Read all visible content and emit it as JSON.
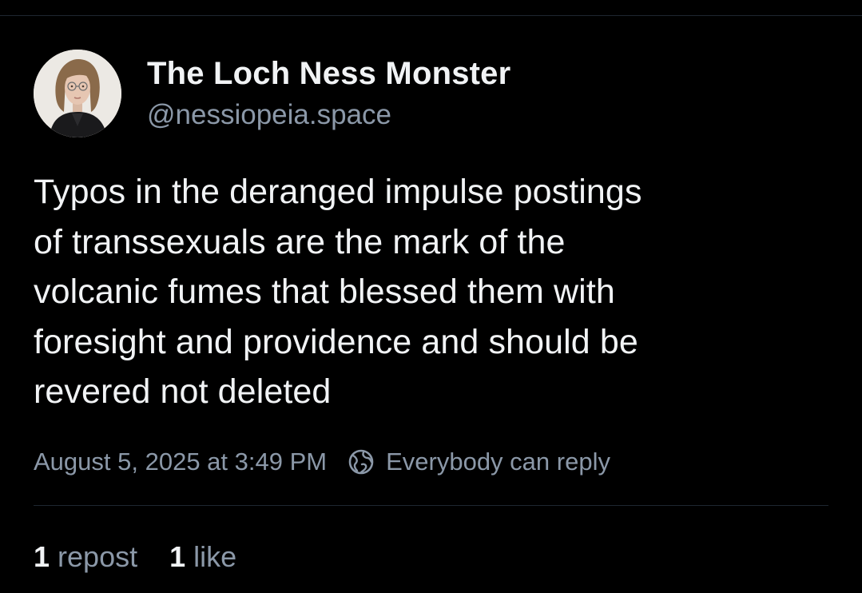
{
  "author": {
    "display_name": "The Loch Ness Monster",
    "handle": "@nessiopeia.space"
  },
  "post": {
    "text": "Typos in the deranged impulse postings\nof transsexuals are the mark of the\nvolcanic fumes that blessed them with\nforesight and providence and should be\nrevered not deleted",
    "timestamp": "August 5, 2025 at 3:49 PM",
    "reply_setting": "Everybody can reply",
    "reply_setting_icon": "globe-icon"
  },
  "stats": {
    "reposts": {
      "count": "1",
      "label": "repost"
    },
    "likes": {
      "count": "1",
      "label": "like"
    }
  },
  "colors": {
    "background": "#000000",
    "text_primary": "#f1f3f5",
    "text_secondary": "#8b98a8",
    "divider": "#1e2630"
  }
}
